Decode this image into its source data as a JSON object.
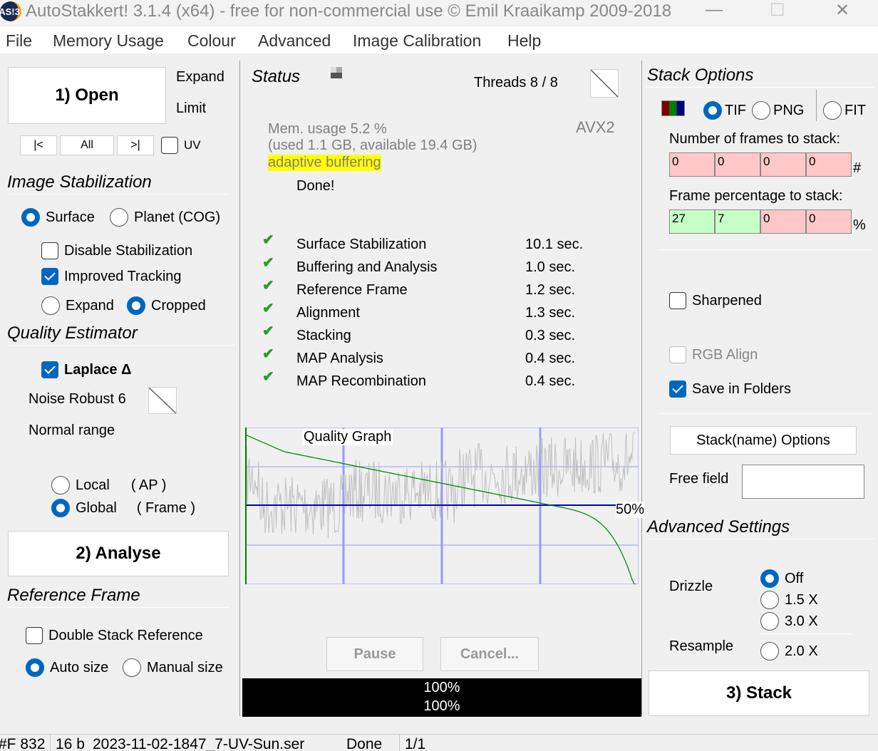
{
  "window": {
    "title": "AutoStakkert! 3.1.4 (x64) - free for non-commercial use © Emil Kraaikamp 2009-2018",
    "logo": "AS!3",
    "minimize": "—",
    "maximize": "☐",
    "close": "✕"
  },
  "menu": [
    "File",
    "Memory Usage",
    "Colour",
    "Advanced",
    "Image Calibration",
    "Help"
  ],
  "left": {
    "open": "1) Open",
    "expand": "Expand",
    "limit": "Limit",
    "nav": {
      "first": "|<",
      "all": "All",
      "last": ">|",
      "uv": "UV",
      "uv_checked": false
    },
    "stab": {
      "title": "Image Stabilization",
      "surface": "Surface",
      "planet": "Planet (COG)",
      "mode": "Surface",
      "disable": "Disable Stabilization",
      "disable_checked": false,
      "improved": "Improved Tracking",
      "improved_checked": true,
      "expand": "Expand",
      "cropped": "Cropped",
      "crop_mode": "Cropped"
    },
    "quality": {
      "title": "Quality Estimator",
      "laplace": "Laplace Δ",
      "laplace_checked": true,
      "noise": "Noise Robust 6",
      "range": "Normal range",
      "local": "Local",
      "local_sub": "( AP )",
      "global": "Global",
      "global_sub": "( Frame )",
      "mode": "Global"
    },
    "analyse": "2) Analyse",
    "ref": {
      "title": "Reference Frame",
      "double": "Double Stack Reference",
      "double_checked": false,
      "auto": "Auto size",
      "manual": "Manual size",
      "mode": "Auto size"
    }
  },
  "status": {
    "title": "Status",
    "threads": "Threads 8 / 8",
    "mem1": "Mem. usage 5.2 %",
    "mem2": "(used 1.1 GB, available 19.4 GB)",
    "buffering": "adaptive buffering",
    "avx": "AVX2",
    "done": "Done!",
    "steps": [
      {
        "name": "Surface Stabilization",
        "time": "10.1 sec."
      },
      {
        "name": "Buffering and Analysis",
        "time": "1.0 sec."
      },
      {
        "name": "Reference Frame",
        "time": "1.2 sec."
      },
      {
        "name": "Alignment",
        "time": "1.3 sec."
      },
      {
        "name": "Stacking",
        "time": "0.3 sec."
      },
      {
        "name": "MAP Analysis",
        "time": "0.4 sec."
      },
      {
        "name": "MAP Recombination",
        "time": "0.4 sec."
      }
    ],
    "check": "✔",
    "graph": {
      "title": "Quality Graph",
      "marker": "50%",
      "colors": {
        "sorted": "#008000",
        "raw": "#c0c0c0",
        "grid": "#9999ff",
        "mid": "#0000cc"
      }
    },
    "pause": "Pause",
    "cancel": "Cancel...",
    "progress1": "100%",
    "progress2": "100%",
    "progress_value": 100
  },
  "stack": {
    "title": "Stack Options",
    "formats": {
      "tif": "TIF",
      "png": "PNG",
      "fit": "FIT",
      "selected": "TIF"
    },
    "frames_label": "Number of frames to stack:",
    "frames": [
      "0",
      "0",
      "0",
      "0"
    ],
    "frames_unit": "#",
    "pct_label": "Frame percentage to stack:",
    "pct": [
      "27",
      "7",
      "0",
      "0"
    ],
    "pct_unit": "%",
    "sharpened": "Sharpened",
    "sharpened_checked": false,
    "rgb": "RGB Align",
    "rgb_checked": false,
    "folders": "Save in Folders",
    "folders_checked": true,
    "name_options": "Stack(name) Options",
    "free_field": "Free field",
    "free_value": "",
    "adv_title": "Advanced Settings",
    "drizzle": "Drizzle",
    "d_off": "Off",
    "d_15": "1.5 X",
    "d_30": "3.0 X",
    "drizzle_mode": "Off",
    "resample": "Resample",
    "r_20": "2.0 X",
    "stack_btn": "3) Stack"
  },
  "statusbar": {
    "frames": "#F 832",
    "bits": "16 b",
    "file": "2023-11-02-1847_7-UV-Sun.ser",
    "state": "Done",
    "count": "1/1"
  }
}
